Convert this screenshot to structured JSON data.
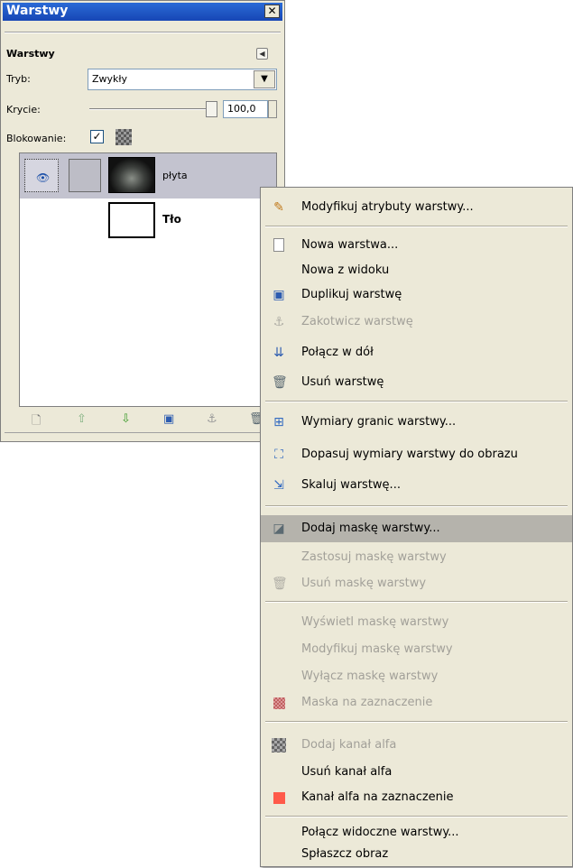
{
  "window": {
    "title": "Warstwy",
    "close_glyph": "✕"
  },
  "panel": {
    "heading": "Warstwy",
    "mode_label": "Tryb:",
    "mode_value": "Zwykły",
    "opacity_label": "Krycie:",
    "opacity_value": "100,0",
    "opacity_percent": 100,
    "lock_label": "Blokowanie:",
    "lock_checked": true
  },
  "layers": [
    {
      "name": "płyta",
      "visible": true,
      "selected": true
    },
    {
      "name": "Tło",
      "visible": false,
      "selected": false
    }
  ],
  "toolbar_icons": [
    "new-layer-icon",
    "raise-layer-icon",
    "lower-layer-icon",
    "duplicate-layer-icon",
    "anchor-layer-icon",
    "delete-layer-icon"
  ],
  "menu": {
    "items": [
      {
        "label": "Modyfikuj atrybuty warstwy...",
        "enabled": true,
        "icon": "pencil-icon"
      },
      {
        "label": "Nowa warstwa...",
        "enabled": true,
        "icon": "new-page-icon"
      },
      {
        "label": "Nowa z widoku",
        "enabled": true,
        "icon": ""
      },
      {
        "label": "Duplikuj warstwę",
        "enabled": true,
        "icon": "duplicate-icon"
      },
      {
        "label": "Zakotwicz warstwę",
        "enabled": false,
        "icon": "anchor-icon"
      },
      {
        "label": "Połącz w dół",
        "enabled": true,
        "icon": "merge-down-icon"
      },
      {
        "label": "Usuń warstwę",
        "enabled": true,
        "icon": "trash-icon"
      },
      {
        "label": "Wymiary granic warstwy...",
        "enabled": true,
        "icon": "layer-boundary-icon"
      },
      {
        "label": "Dopasuj wymiary warstwy do obrazu",
        "enabled": true,
        "icon": "fit-canvas-icon"
      },
      {
        "label": "Skaluj warstwę...",
        "enabled": true,
        "icon": "scale-icon"
      },
      {
        "label": "Dodaj maskę warstwy...",
        "enabled": true,
        "highlighted": true,
        "icon": "add-mask-icon"
      },
      {
        "label": "Zastosuj maskę warstwy",
        "enabled": false,
        "icon": ""
      },
      {
        "label": "Usuń maskę warstwy",
        "enabled": false,
        "icon": "trash-icon"
      },
      {
        "label": "Wyświetl maskę warstwy",
        "enabled": false,
        "icon": ""
      },
      {
        "label": "Modyfikuj maskę warstwy",
        "enabled": false,
        "icon": ""
      },
      {
        "label": "Wyłącz maskę warstwy",
        "enabled": false,
        "icon": ""
      },
      {
        "label": "Maska na zaznaczenie",
        "enabled": false,
        "icon": "mask-to-selection-icon"
      },
      {
        "label": "Dodaj kanał alfa",
        "enabled": false,
        "icon": "alpha-icon"
      },
      {
        "label": "Usuń kanał alfa",
        "enabled": true,
        "icon": ""
      },
      {
        "label": "Kanał alfa na zaznaczenie",
        "enabled": true,
        "icon": "alpha-to-selection-icon"
      },
      {
        "label": "Połącz widoczne warstwy...",
        "enabled": true,
        "icon": ""
      },
      {
        "label": "Spłaszcz obraz",
        "enabled": true,
        "icon": ""
      }
    ]
  }
}
